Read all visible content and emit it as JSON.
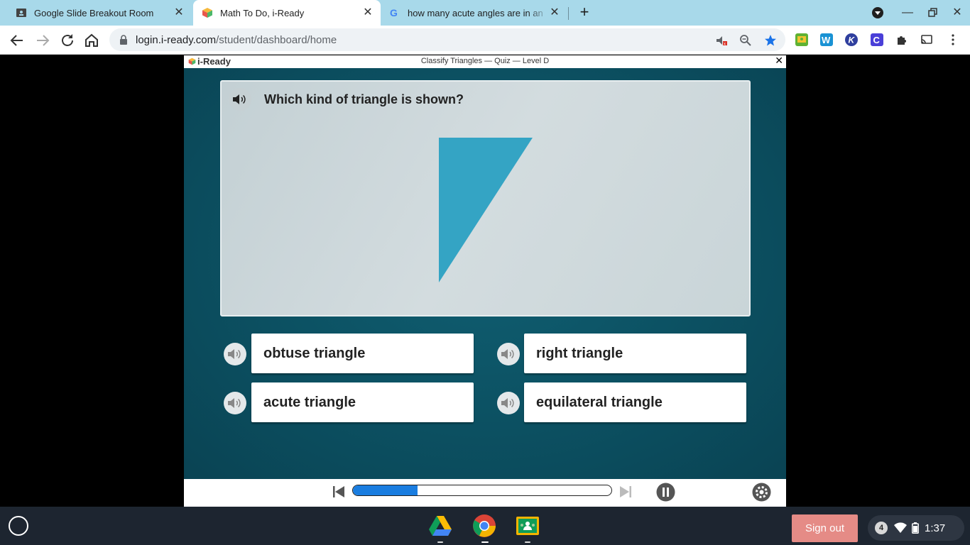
{
  "browser": {
    "tabs": [
      {
        "title": "Google Slide Breakout Room",
        "active": false
      },
      {
        "title": "Math To Do, i-Ready",
        "active": true
      },
      {
        "title": "how many acute angles are in an",
        "active": false
      }
    ],
    "url_host": "login.i-ready.com",
    "url_path": "/student/dashboard/home"
  },
  "app": {
    "brand": "i-Ready",
    "lesson_title": "Classify Triangles — Quiz — Level D",
    "question": "Which kind of triangle is shown?",
    "choices": [
      "obtuse triangle",
      "right triangle",
      "acute triangle",
      "equilateral triangle"
    ],
    "triangle_color": "#34a4c4",
    "progress": 0.25,
    "progress_color": "#1a7de0"
  },
  "shelf": {
    "apps": [
      "google-drive",
      "chrome",
      "google-classroom"
    ],
    "sign_out": "Sign out",
    "notification_count": "4",
    "time": "1:37"
  },
  "colors": {
    "tabstrip": "#a8d9ea",
    "stage": "#0b4c5d",
    "sign_out": "#e58b86"
  }
}
